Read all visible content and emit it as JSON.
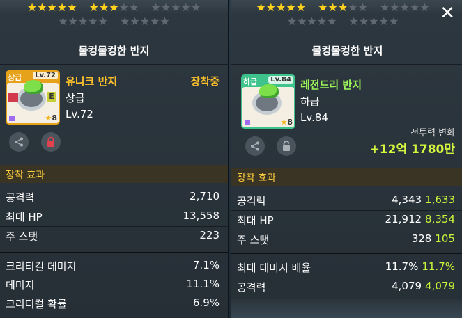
{
  "colors": {
    "unique_name": "#ffc22b",
    "legendary_name": "#9bf55a",
    "unique_border": "#e7a21c",
    "legendary_border": "#3ec38c",
    "section_label": "#ffce3d",
    "diff_positive": "#c6f53a"
  },
  "left": {
    "stars_row1": [
      "★★★★★",
      "★★★★★",
      "★★★★★"
    ],
    "stars_row2": [
      "★★★★★",
      "★★★★★"
    ],
    "stars_row1_lit": [
      5,
      3,
      0
    ],
    "title": "물컹물컹한 반지",
    "item": {
      "grade_badge": "상급",
      "level_badge": "Lv.72",
      "star_count": "8",
      "name": "유니크 반지",
      "grade": "상급",
      "level": "Lv.72",
      "equipped_label": "장착중",
      "icon": "ring-icon"
    },
    "buttons": [
      "share-icon",
      "lock-icon"
    ],
    "section_title": "장착 효과",
    "stats": [
      {
        "label": "공격력",
        "value": "2,710"
      },
      {
        "label": "최대 HP",
        "value": "13,558"
      },
      {
        "label": "주 스탯",
        "value": "223"
      }
    ],
    "stats2": [
      {
        "label": "크리티컬 데미지",
        "value": "7.1%"
      },
      {
        "label": "데미지",
        "value": "11.1%"
      },
      {
        "label": "크리티컬 확률",
        "value": "6.9%"
      }
    ]
  },
  "right": {
    "stars_row1": [
      "★★★★★",
      "★★★★★",
      "★★★★★"
    ],
    "stars_row2": [
      "★★★★★",
      "★★★★★"
    ],
    "stars_row1_lit": [
      5,
      3,
      0
    ],
    "title": "물컹물컹한 반지",
    "item": {
      "grade_badge": "하급",
      "level_badge": "Lv.84",
      "star_count": "8",
      "name": "레전드리 반지",
      "grade": "하급",
      "level": "Lv.84",
      "icon": "ring-icon"
    },
    "buttons": [
      "share-icon",
      "unlock-icon"
    ],
    "power_change_label": "전투력 변화",
    "power_change_value": "+12억 1780만",
    "section_title": "장착 효과",
    "stats": [
      {
        "label": "공격력",
        "value": "4,343",
        "diff": "1,633"
      },
      {
        "label": "최대 HP",
        "value": "21,912",
        "diff": "8,354"
      },
      {
        "label": "주 스탯",
        "value": "328",
        "diff": "105"
      }
    ],
    "stats2": [
      {
        "label": "최대 데미지 배율",
        "value": "11.7%",
        "diff": "11.7%"
      },
      {
        "label": "공격력",
        "value": "4,079",
        "diff": "4,079"
      }
    ],
    "close_icon": "close-icon"
  }
}
